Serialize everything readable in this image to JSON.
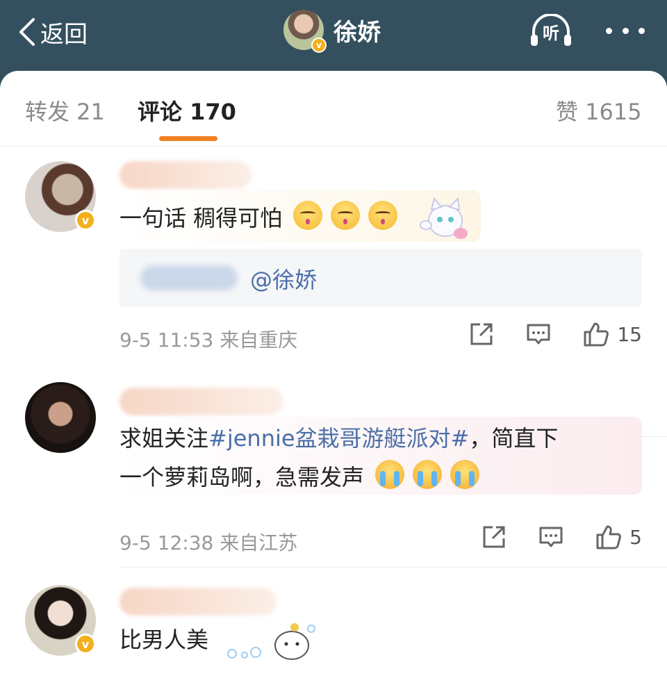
{
  "header": {
    "back_label": "返回",
    "title": "徐娇",
    "listen_label": "听",
    "verified_mark": "v"
  },
  "tabs": [
    {
      "label": "转发 21"
    },
    {
      "label": "评论 170",
      "active": true
    },
    {
      "label": "赞 1615"
    }
  ],
  "colors": {
    "header_bg": "#34505f",
    "accent_underline": "#f08121",
    "topic_link": "#4a6ea8",
    "verified_badge": "#f2b01e"
  },
  "comments": [
    {
      "text": "一句话 稠得可怕",
      "emojis": [
        "kiss-face",
        "kiss-face",
        "kiss-face"
      ],
      "sticker": "cat-sticker",
      "quote_mention": "@徐娇",
      "time": "9-5 11:53 来自重庆",
      "likes": "15"
    },
    {
      "text_part1": "求姐关注",
      "topic": "#jennie盆栽哥游艇派对#",
      "text_part2": "，简直下",
      "text_line2": "一个萝莉岛啊，急需发声",
      "emojis": [
        "crying-face",
        "crying-face",
        "crying-face"
      ],
      "time": "9-5 12:38 来自江苏",
      "likes": "5"
    },
    {
      "text": "比男人美",
      "sticker": "bubble-character-sticker"
    }
  ]
}
